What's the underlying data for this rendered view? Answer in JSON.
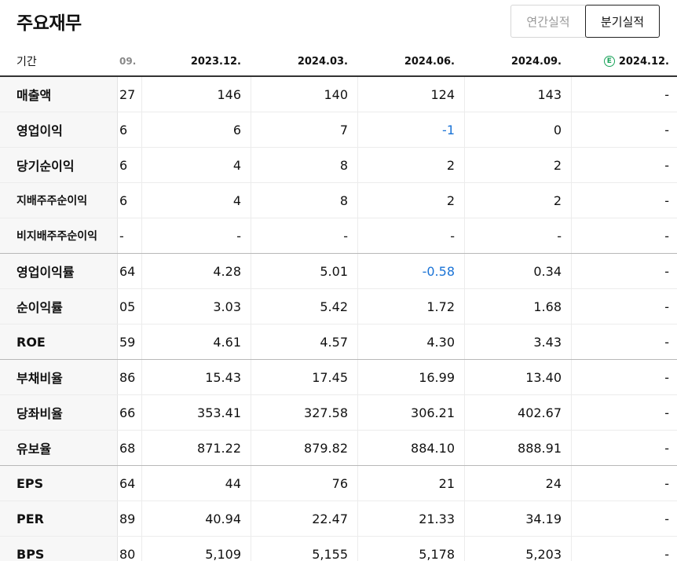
{
  "header": {
    "title": "주요재무",
    "toggle_annual": "연간실적",
    "toggle_quarterly": "분기실적"
  },
  "table": {
    "period_label": "기간",
    "columns": [
      "09.",
      "2023.12.",
      "2024.03.",
      "2024.06.",
      "2024.09.",
      "2024.12."
    ],
    "estimate_icon": "E",
    "rows": [
      {
        "label": "매출액",
        "values": [
          "27",
          "146",
          "140",
          "124",
          "143",
          "-"
        ]
      },
      {
        "label": "영업이익",
        "values": [
          "6",
          "6",
          "7",
          "-1",
          "0",
          "-"
        ]
      },
      {
        "label": "당기순이익",
        "values": [
          "6",
          "4",
          "8",
          "2",
          "2",
          "-"
        ]
      },
      {
        "label": "지배주주순이익",
        "values": [
          "6",
          "4",
          "8",
          "2",
          "2",
          "-"
        ]
      },
      {
        "label": "비지배주주순이익",
        "values": [
          "-",
          "-",
          "-",
          "-",
          "-",
          "-"
        ]
      },
      {
        "label": "영업이익률",
        "values": [
          "64",
          "4.28",
          "5.01",
          "-0.58",
          "0.34",
          "-"
        ]
      },
      {
        "label": "순이익률",
        "values": [
          "05",
          "3.03",
          "5.42",
          "1.72",
          "1.68",
          "-"
        ]
      },
      {
        "label": "ROE",
        "values": [
          "59",
          "4.61",
          "4.57",
          "4.30",
          "3.43",
          "-"
        ]
      },
      {
        "label": "부채비율",
        "values": [
          "86",
          "15.43",
          "17.45",
          "16.99",
          "13.40",
          "-"
        ]
      },
      {
        "label": "당좌비율",
        "values": [
          "66",
          "353.41",
          "327.58",
          "306.21",
          "402.67",
          "-"
        ]
      },
      {
        "label": "유보율",
        "values": [
          "68",
          "871.22",
          "879.82",
          "884.10",
          "888.91",
          "-"
        ]
      },
      {
        "label": "EPS",
        "values": [
          "64",
          "44",
          "76",
          "21",
          "24",
          "-"
        ]
      },
      {
        "label": "PER",
        "values": [
          "89",
          "40.94",
          "22.47",
          "21.33",
          "34.19",
          "-"
        ]
      },
      {
        "label": "BPS",
        "values": [
          "80",
          "5,109",
          "5,155",
          "5,178",
          "5,203",
          "-"
        ]
      }
    ]
  },
  "colors": {
    "negative": "#1a73d6",
    "estimate": "#1aa35a"
  }
}
